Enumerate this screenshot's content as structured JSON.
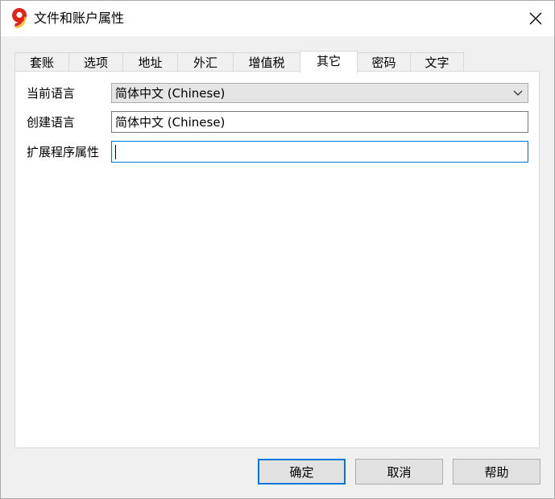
{
  "window": {
    "title": "文件和账户属性",
    "icon": "banana-9-logo",
    "close_icon": "close-icon"
  },
  "tabs": [
    {
      "label": "套账",
      "active": false
    },
    {
      "label": "选项",
      "active": false
    },
    {
      "label": "地址",
      "active": false
    },
    {
      "label": "外汇",
      "active": false
    },
    {
      "label": "增值税",
      "active": false
    },
    {
      "label": "其它",
      "active": true
    },
    {
      "label": "密码",
      "active": false
    },
    {
      "label": "文字",
      "active": false
    }
  ],
  "fields": {
    "current_language": {
      "label": "当前语言",
      "value": "简体中文 (Chinese)"
    },
    "creation_language": {
      "label": "创建语言",
      "value": "简体中文 (Chinese)"
    },
    "extension_properties": {
      "label": "扩展程序属性",
      "value": ""
    }
  },
  "buttons": {
    "ok": "确定",
    "cancel": "取消",
    "help": "帮助"
  },
  "colors": {
    "accent": "#0078d7",
    "logo_red": "#e2231a",
    "logo_yellow": "#f7c300"
  }
}
